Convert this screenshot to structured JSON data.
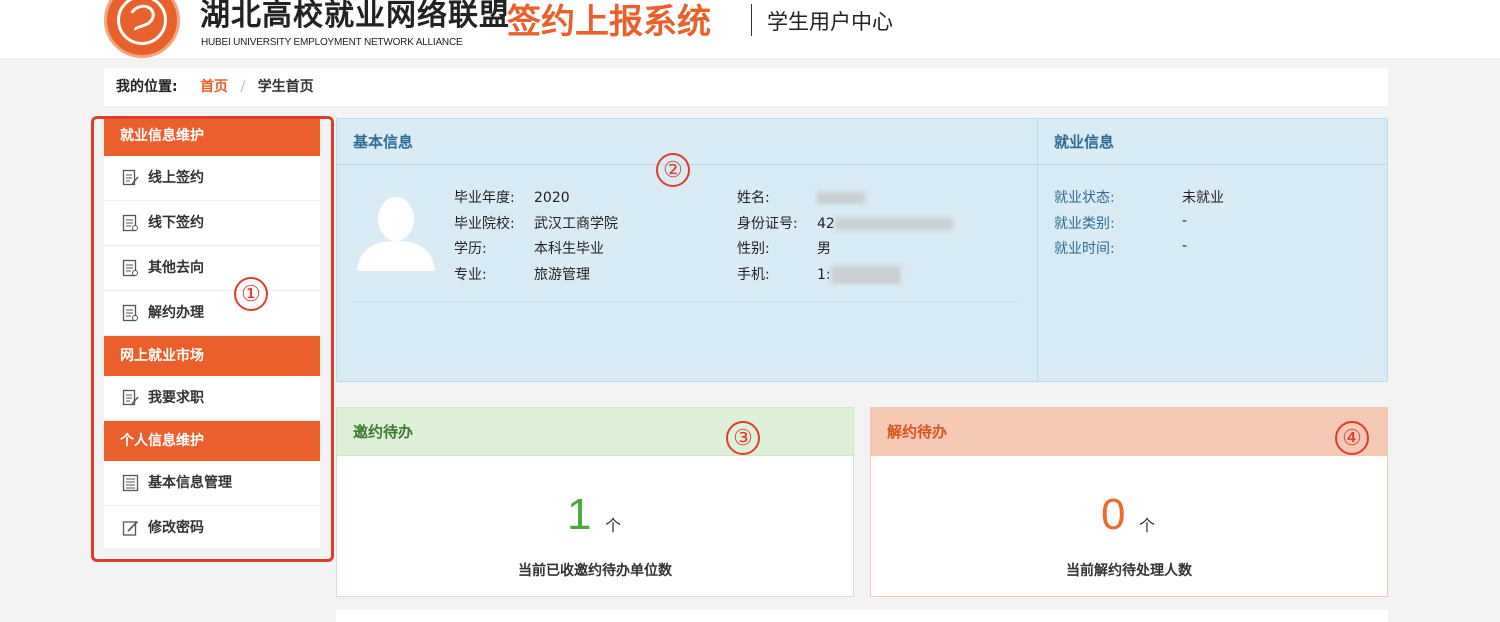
{
  "header": {
    "org_name_cn": "湖北高校就业网络联盟",
    "org_name_en": "HUBEI UNIVERSITY EMPLOYMENT NETWORK ALLIANCE",
    "system_name": "签约上报系统",
    "sub_title": "学生用户中心",
    "logo_icon": "university-alliance-logo",
    "accent_color": "#e8612c"
  },
  "breadcrumb": {
    "label": "我的位置:",
    "home": "首页",
    "separator": "/",
    "current": "学生首页"
  },
  "sidebar": {
    "sections": [
      {
        "title": "就业信息维护",
        "items": [
          {
            "label": "线上签约",
            "icon": "document-edit-icon"
          },
          {
            "label": "线下签约",
            "icon": "document-icon"
          },
          {
            "label": "其他去向",
            "icon": "document-icon"
          },
          {
            "label": "解约办理",
            "icon": "document-icon"
          }
        ]
      },
      {
        "title": "网上就业市场",
        "items": [
          {
            "label": "我要求职",
            "icon": "document-edit-icon"
          }
        ]
      },
      {
        "title": "个人信息维护",
        "items": [
          {
            "label": "基本信息管理",
            "icon": "list-doc-icon"
          },
          {
            "label": "修改密码",
            "icon": "edit-icon"
          }
        ]
      }
    ]
  },
  "annotations": [
    "①",
    "②",
    "③",
    "④"
  ],
  "basic_info": {
    "title": "基本信息",
    "fields": {
      "grad_year_label": "毕业年度:",
      "grad_year": "2020",
      "school_label": "毕业院校:",
      "school": "武汉工商学院",
      "degree_label": "学历:",
      "degree": "本科生毕业",
      "major_label": "专业:",
      "major": "旅游管理",
      "name_label": "姓名:",
      "id_label": "身份证号:",
      "id_prefix": "42",
      "gender_label": "性别:",
      "gender": "男",
      "phone_label": "手机:",
      "phone_prefix": "1:"
    }
  },
  "employment_info": {
    "title": "就业信息",
    "status_label": "就业状态:",
    "status": "未就业",
    "type_label": "就业类别:",
    "type": "-",
    "time_label": "就业时间:",
    "time": "-"
  },
  "invite_todo": {
    "title": "邀约待办",
    "count": "1",
    "unit": "个",
    "desc": "当前已收邀约待办单位数",
    "color": "#4aa83a"
  },
  "cancel_todo": {
    "title": "解约待办",
    "count": "0",
    "unit": "个",
    "desc": "当前解约待处理人数",
    "color": "#ea6b2f"
  }
}
